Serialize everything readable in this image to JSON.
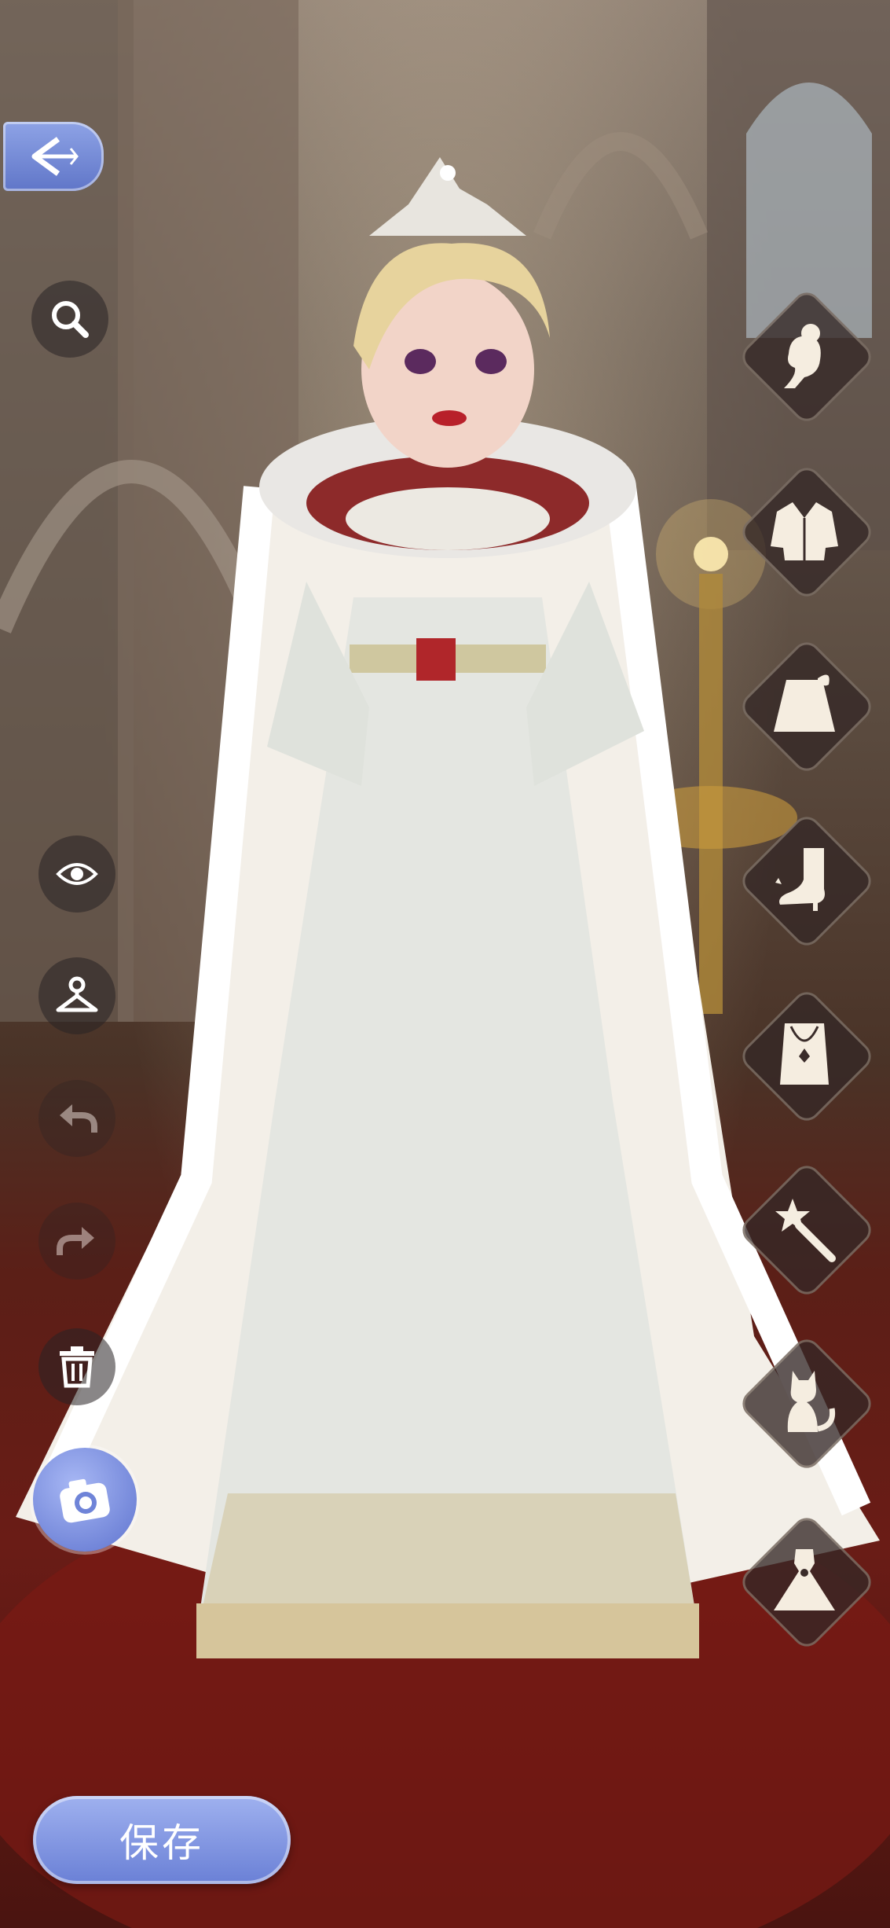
{
  "toolbar": {
    "back_icon": "back-arrow-icon",
    "left_tools": [
      "zoom-icon",
      "eye-icon",
      "hanger-icon",
      "undo-icon",
      "redo-icon",
      "trash-icon"
    ],
    "camera_icon": "camera-icon"
  },
  "categories": [
    {
      "id": "hair",
      "icon": "hair-profile-icon"
    },
    {
      "id": "top",
      "icon": "jacket-icon"
    },
    {
      "id": "bottom",
      "icon": "skirt-icon"
    },
    {
      "id": "shoes",
      "icon": "boot-icon"
    },
    {
      "id": "accessory",
      "icon": "necklace-icon"
    },
    {
      "id": "effects",
      "icon": "magic-wand-icon"
    },
    {
      "id": "pet",
      "icon": "cat-icon"
    },
    {
      "id": "dress",
      "icon": "dress-icon"
    }
  ],
  "save": {
    "label": "保存"
  },
  "colors": {
    "accent": "#6f84d8",
    "button_dark": "#2f2729"
  }
}
